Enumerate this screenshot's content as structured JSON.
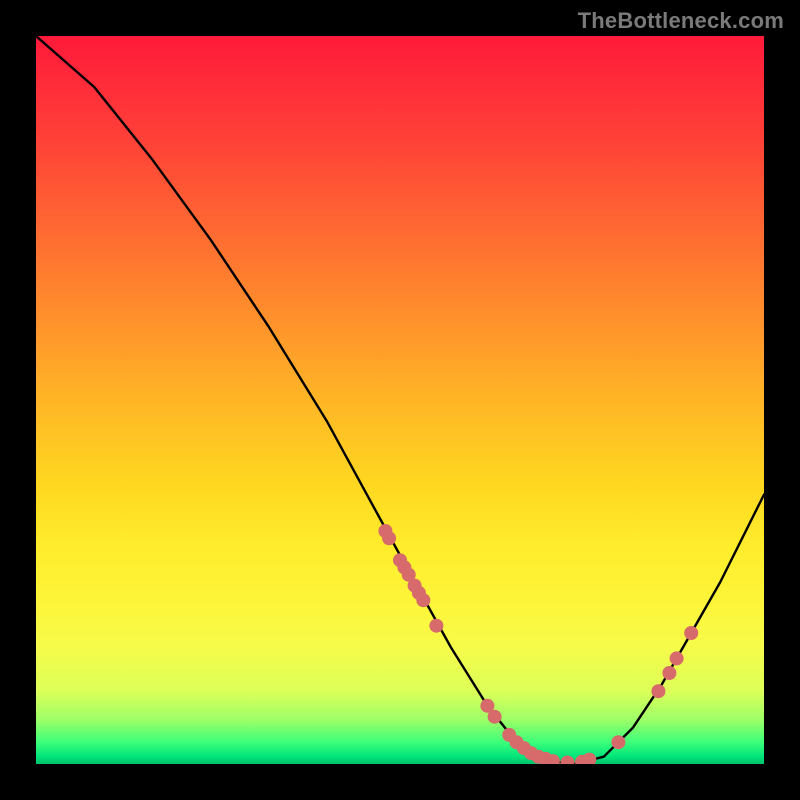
{
  "attribution": "TheBottleneck.com",
  "chart_data": {
    "type": "line",
    "title": "",
    "xlabel": "",
    "ylabel": "",
    "xlim": [
      0,
      100
    ],
    "ylim": [
      0,
      100
    ],
    "grid": false,
    "curve": [
      {
        "x": 0,
        "y": 100
      },
      {
        "x": 8,
        "y": 93
      },
      {
        "x": 16,
        "y": 83
      },
      {
        "x": 24,
        "y": 72
      },
      {
        "x": 32,
        "y": 60
      },
      {
        "x": 40,
        "y": 47
      },
      {
        "x": 46,
        "y": 36
      },
      {
        "x": 52,
        "y": 25
      },
      {
        "x": 57,
        "y": 16
      },
      {
        "x": 62,
        "y": 8
      },
      {
        "x": 66,
        "y": 3
      },
      {
        "x": 70,
        "y": 0.5
      },
      {
        "x": 74,
        "y": 0
      },
      {
        "x": 78,
        "y": 1
      },
      {
        "x": 82,
        "y": 5
      },
      {
        "x": 86,
        "y": 11
      },
      {
        "x": 90,
        "y": 18
      },
      {
        "x": 94,
        "y": 25
      },
      {
        "x": 100,
        "y": 37
      }
    ],
    "markers": [
      {
        "x": 48,
        "y": 32
      },
      {
        "x": 48.5,
        "y": 31
      },
      {
        "x": 50,
        "y": 28
      },
      {
        "x": 50.6,
        "y": 27
      },
      {
        "x": 51.2,
        "y": 26
      },
      {
        "x": 52,
        "y": 24.5
      },
      {
        "x": 52.6,
        "y": 23.5
      },
      {
        "x": 53.2,
        "y": 22.5
      },
      {
        "x": 55,
        "y": 19
      },
      {
        "x": 62,
        "y": 8
      },
      {
        "x": 63,
        "y": 6.5
      },
      {
        "x": 65,
        "y": 4
      },
      {
        "x": 66,
        "y": 3
      },
      {
        "x": 67,
        "y": 2.2
      },
      {
        "x": 68,
        "y": 1.5
      },
      {
        "x": 69,
        "y": 1
      },
      {
        "x": 70,
        "y": 0.7
      },
      {
        "x": 71,
        "y": 0.4
      },
      {
        "x": 73,
        "y": 0.2
      },
      {
        "x": 75,
        "y": 0.3
      },
      {
        "x": 76,
        "y": 0.6
      },
      {
        "x": 80,
        "y": 3
      },
      {
        "x": 85.5,
        "y": 10
      },
      {
        "x": 87,
        "y": 12.5
      },
      {
        "x": 88,
        "y": 14.5
      },
      {
        "x": 90,
        "y": 18
      }
    ],
    "colors": {
      "curve": "#000000",
      "marker_fill": "#d76a6a",
      "marker_stroke": "#c95858"
    }
  }
}
